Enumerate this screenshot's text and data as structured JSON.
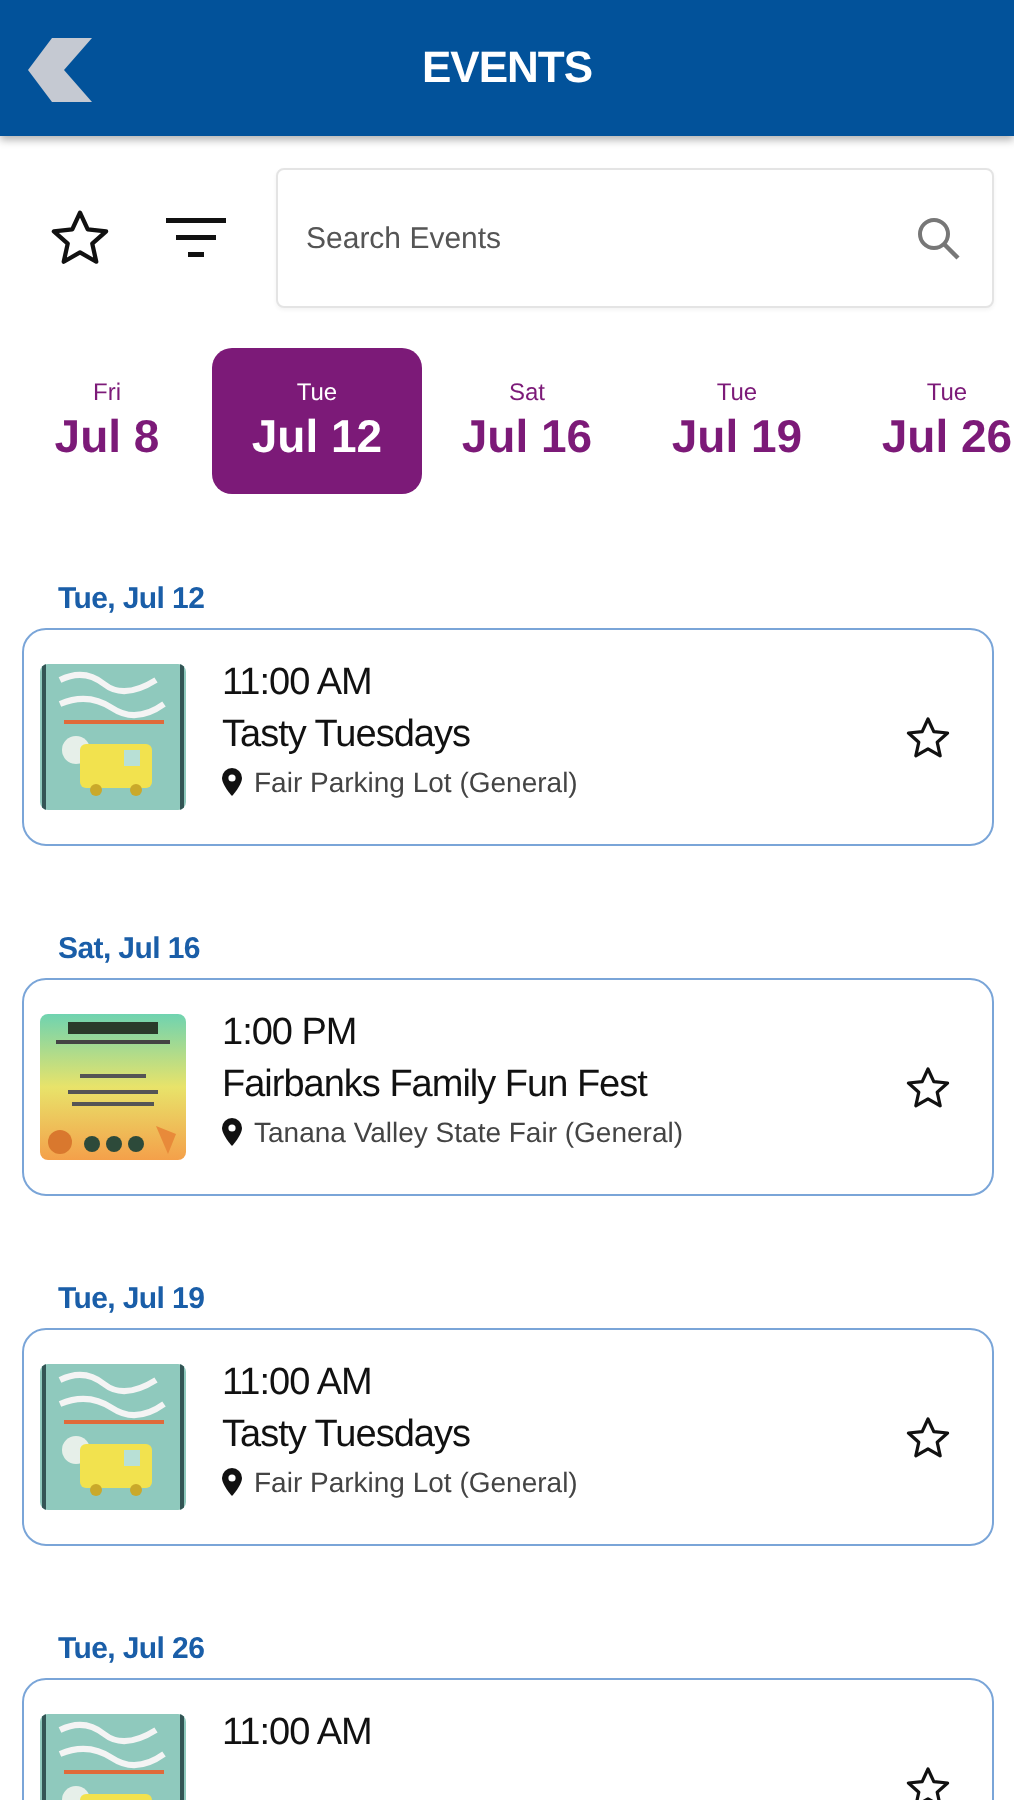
{
  "header": {
    "title": "EVENTS"
  },
  "search": {
    "placeholder": "Search Events"
  },
  "date_tabs": [
    {
      "weekday": "Fri",
      "date": "Jul 8",
      "selected": false
    },
    {
      "weekday": "Tue",
      "date": "Jul 12",
      "selected": true
    },
    {
      "weekday": "Sat",
      "date": "Jul 16",
      "selected": false
    },
    {
      "weekday": "Tue",
      "date": "Jul 19",
      "selected": false
    },
    {
      "weekday": "Tue",
      "date": "Jul 26",
      "selected": false
    }
  ],
  "sections": [
    {
      "heading": "Tue, Jul 12",
      "events": [
        {
          "time": "11:00 AM",
          "title": "Tasty Tuesdays",
          "location": "Fair Parking Lot (General)",
          "favorite": false
        }
      ]
    },
    {
      "heading": "Sat, Jul 16",
      "events": [
        {
          "time": "1:00 PM",
          "title": "Fairbanks Family Fun Fest",
          "location": "Tanana Valley State Fair (General)",
          "favorite": false
        }
      ]
    },
    {
      "heading": "Tue, Jul 19",
      "events": [
        {
          "time": "11:00 AM",
          "title": "Tasty Tuesdays",
          "location": "Fair Parking Lot (General)",
          "favorite": false
        }
      ]
    },
    {
      "heading": "Tue, Jul 26",
      "events": [
        {
          "time": "11:00 AM",
          "favorite": false
        }
      ]
    }
  ]
}
